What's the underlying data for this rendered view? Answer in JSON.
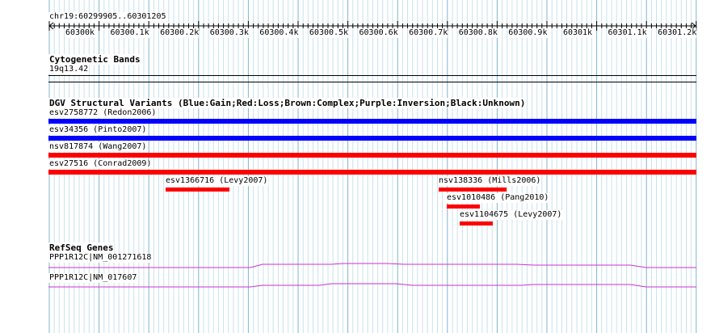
{
  "location": "chr19:60299905..60301205",
  "ruler": {
    "ticks": [
      "60300k",
      "60300.1k",
      "60300.2k",
      "60300.3k",
      "60300.4k",
      "60300.5k",
      "60300.6k",
      "60300.7k",
      "60300.8k",
      "60300.9k",
      "60301k",
      "60301.1k",
      "60301.2k"
    ]
  },
  "tracks": {
    "cyto": {
      "title": "Cytogenetic Bands",
      "band": "19q13.42"
    },
    "dgv": {
      "title": "DGV Structural Variants (Blue:Gain;Red:Loss;Brown:Complex;Purple:Inversion;Black:Unknown)",
      "colors": {
        "gain": "#0000ff",
        "loss": "#ff0000"
      },
      "variants": [
        {
          "label": "esv2758772 (Redon2006)",
          "type": "gain"
        },
        {
          "label": "esv34356 (Pinto2007)",
          "type": "gain"
        },
        {
          "label": "nsv817874 (Wang2007)",
          "type": "loss"
        },
        {
          "label": "esv27516 (Conrad2009)",
          "type": "loss"
        },
        {
          "label": "esv1366716 (Levy2007)",
          "type": "loss"
        },
        {
          "label": "nsv138336 (Mills2006)",
          "type": "loss"
        },
        {
          "label": "esv1010486 (Pang2010)",
          "type": "loss"
        },
        {
          "label": "esv1104675 (Levy2007)",
          "type": "loss"
        }
      ]
    },
    "refseq": {
      "title": "RefSeq Genes",
      "color": "#cc33cc",
      "genes": [
        {
          "label": "PPP1R12C|NM_001271618"
        },
        {
          "label": "PPP1R12C|NM_017607"
        }
      ]
    }
  }
}
